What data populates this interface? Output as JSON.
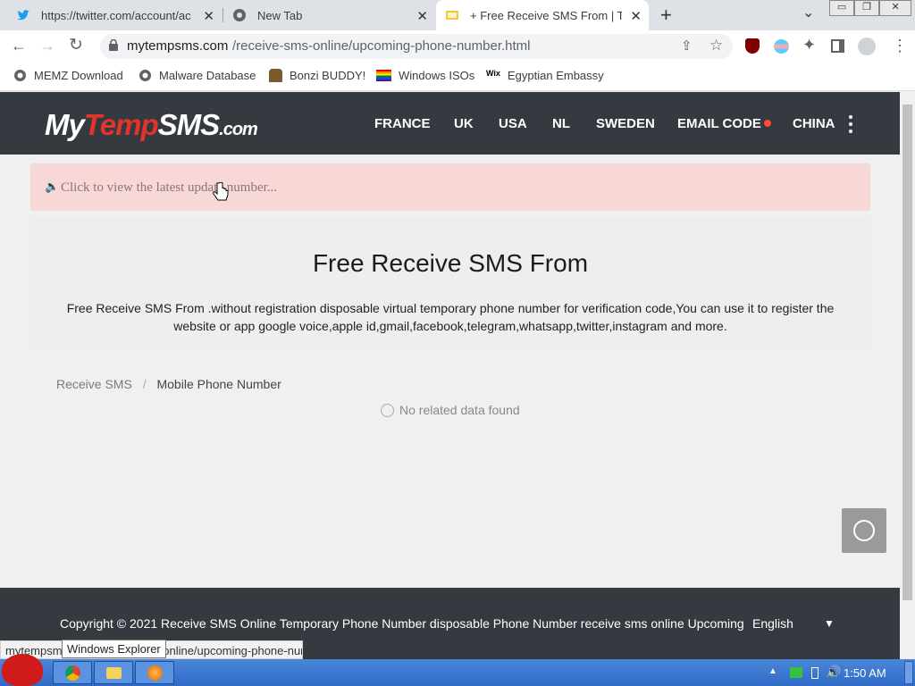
{
  "browser": {
    "tabs": [
      {
        "title": "https://twitter.com/account/ac",
        "close": "✕"
      },
      {
        "title": "New Tab",
        "close": "✕"
      },
      {
        "title": "+ Free Receive SMS From | Ter",
        "close": "✕"
      }
    ],
    "new_tab": "+",
    "tab_menu": "⌄",
    "window_controls": [
      "▭",
      "❐",
      "✕"
    ],
    "url_host": "mytempsms.com",
    "url_path": "/receive-sms-online/upcoming-phone-number.html",
    "bookmarks": [
      "MEMZ Download",
      "Malware Database",
      "Bonzi BUDDY!",
      "Windows ISOs",
      "Egyptian Embassy"
    ]
  },
  "site": {
    "logo": {
      "my": "My",
      "temp": "Temp",
      "sms": "SMS",
      "dom": ".com"
    },
    "nav": [
      "FRANCE",
      "UK",
      "USA",
      "NL",
      "SWEDEN",
      "EMAIL CODE",
      "CHINA"
    ],
    "notice": "Click to view the latest update number...",
    "hero_title": "Free Receive SMS From",
    "hero_desc": "Free Receive SMS From .without registration disposable virtual temporary phone number for verification code,You can use it to register the website or app google voice,apple id,gmail,facebook,telegram,whatsapp,twitter,instagram and more.",
    "breadcrumb": {
      "home": "Receive SMS",
      "sep": "/",
      "current": "Mobile Phone Number"
    },
    "empty": "No related data found",
    "footer_copy": "Copyright © 2021 Receive SMS Online Temporary Phone Number disposable Phone Number receive sms online Upcoming",
    "language": "English"
  },
  "status_url": "mytempsms.com/receive-sms-online/upcoming-phone-number.html",
  "tooltip": "Windows Explorer",
  "clock": "1:50 AM",
  "colors": {
    "header": "#343a40",
    "accent": "#e2342a",
    "notice_bg": "#f8d7d7"
  }
}
